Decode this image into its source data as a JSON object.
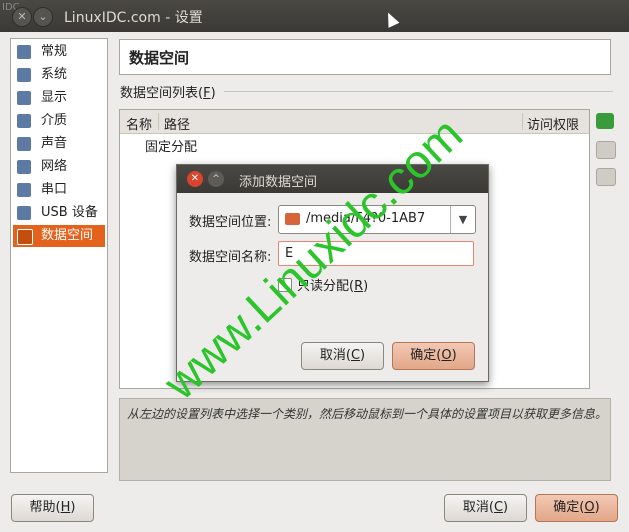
{
  "window": {
    "title": "LinuxIDC.com - 设置",
    "corner_text": "IDC"
  },
  "categories": [
    {
      "label": "常规",
      "icon": "general-icon"
    },
    {
      "label": "系统",
      "icon": "system-icon"
    },
    {
      "label": "显示",
      "icon": "display-icon"
    },
    {
      "label": "介质",
      "icon": "storage-icon"
    },
    {
      "label": "声音",
      "icon": "audio-icon"
    },
    {
      "label": "网络",
      "icon": "network-icon"
    },
    {
      "label": "串口",
      "icon": "serial-icon"
    },
    {
      "label": "USB 设备",
      "icon": "usb-icon"
    },
    {
      "label": "数据空间",
      "icon": "shared-folder-icon",
      "selected": true
    }
  ],
  "section": {
    "title": "数据空间",
    "list_label": "数据空间列表(",
    "list_mnemonic": "F",
    "list_label_end": ")"
  },
  "table": {
    "columns": [
      "名称",
      "路径",
      "访问权限"
    ],
    "group_row": "固定分配"
  },
  "info_text": "从左边的设置列表中选择一个类别，然后移动鼠标到一个具体的设置项目以获取更多信息。",
  "footer": {
    "help": {
      "label": "帮助(",
      "mnemonic": "H",
      "end": ")"
    },
    "cancel": {
      "label": "取消(",
      "mnemonic": "C",
      "end": ")"
    },
    "ok": {
      "label": "确定(",
      "mnemonic": "O",
      "end": ")"
    }
  },
  "dialog": {
    "title": "添加数据空间",
    "path_label": "数据空间位置:",
    "path_value": "/media/F4?0-1AB7",
    "name_label": "数据空间名称:",
    "name_value": "E",
    "readonly_label": "只读分配(",
    "readonly_mnemonic": "R",
    "readonly_end": ")",
    "cancel": {
      "label": "取消(",
      "mnemonic": "C",
      "end": ")"
    },
    "ok": {
      "label": "确定(",
      "mnemonic": "O",
      "end": ")"
    }
  },
  "watermark": "www.Linuxidc.com",
  "colors": {
    "accent": "#e3621c",
    "watermark": "#2bc52b"
  }
}
